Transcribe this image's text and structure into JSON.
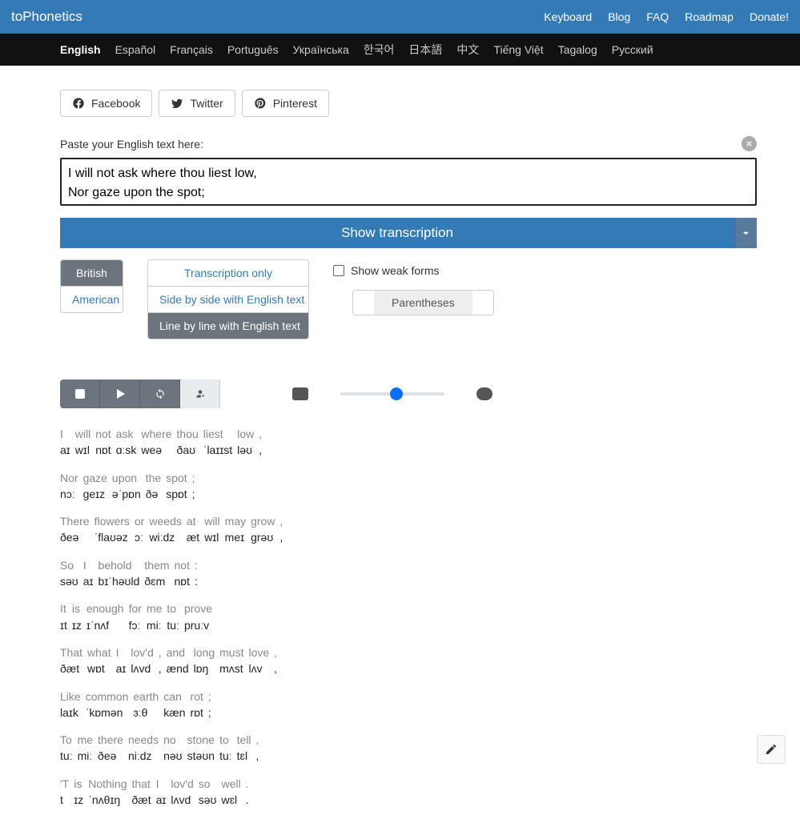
{
  "brand": "toPhonetics",
  "top_links": [
    "Keyboard",
    "Blog",
    "FAQ",
    "Roadmap",
    "Donate!"
  ],
  "languages": [
    "English",
    "Español",
    "Français",
    "Português",
    "Українська",
    "한국어",
    "日本語",
    "中文",
    "Tiếng Việt",
    "Tagalog",
    "Русский"
  ],
  "active_language": "English",
  "share": {
    "facebook": "Facebook",
    "twitter": "Twitter",
    "pinterest": "Pinterest"
  },
  "paste_label": "Paste your English text here:",
  "input_text": "I will not ask where thou liest low,\nNor gaze upon the spot;",
  "show_btn": "Show transcription",
  "dialect": {
    "options": [
      "British",
      "American"
    ],
    "selected": "British"
  },
  "layout_mode": {
    "options": [
      "Transcription only",
      "Side by side with English text",
      "Line by line with English text"
    ],
    "selected": "Line by line with English text"
  },
  "weak_forms_label": "Show weak forms",
  "weak_forms_checked": false,
  "parentheses_label": "Parentheses",
  "output_lines": [
    {
      "pairs": [
        [
          "I",
          "aɪ"
        ],
        [
          "will",
          "wɪl"
        ],
        [
          "not",
          "nɒt"
        ],
        [
          "ask",
          "ɑːsk"
        ],
        [
          "where",
          "weə"
        ],
        [
          "thou",
          "ðaʊ"
        ],
        [
          "liest",
          "ˈlaɪɪst"
        ],
        [
          "low",
          "ləʊ"
        ]
      ],
      "punct": ","
    },
    {
      "pairs": [
        [
          "Nor",
          "nɔː"
        ],
        [
          "gaze",
          "ɡeɪz"
        ],
        [
          "upon",
          "əˈpɒn"
        ],
        [
          "the",
          "ðə"
        ],
        [
          "spot",
          "spɒt"
        ]
      ],
      "punct": ";"
    },
    {
      "pairs": [
        [
          "There",
          "ðeə"
        ],
        [
          "flowers",
          "ˈflaʊəz"
        ],
        [
          "or",
          "ɔː"
        ],
        [
          "weeds",
          "wiːdz"
        ],
        [
          "at",
          "æt"
        ],
        [
          "will",
          "wɪl"
        ],
        [
          "may",
          "meɪ"
        ],
        [
          "grow",
          "ɡrəʊ"
        ]
      ],
      "punct": ","
    },
    {
      "pairs": [
        [
          "So",
          "səʊ"
        ],
        [
          "I",
          "aɪ"
        ],
        [
          "behold",
          "bɪˈhəʊld"
        ],
        [
          "them",
          "ðɛm"
        ],
        [
          "not",
          "nɒt"
        ]
      ],
      "punct": ":"
    },
    {
      "pairs": [
        [
          "It",
          "ɪt"
        ],
        [
          "is",
          "ɪz"
        ],
        [
          "enough",
          "ɪˈnʌf"
        ],
        [
          "for",
          "fɔː"
        ],
        [
          "me",
          "miː"
        ],
        [
          "to",
          "tuː"
        ],
        [
          "prove",
          "pruːv"
        ]
      ],
      "punct": ""
    },
    {
      "pairs": [
        [
          "That",
          "ðæt"
        ],
        [
          "what",
          "wɒt"
        ],
        [
          "I",
          "aɪ"
        ],
        [
          "lov'd",
          "lʌvd"
        ],
        [
          ",",
          ","
        ],
        [
          "and",
          "ænd"
        ],
        [
          "long",
          "lɒŋ"
        ],
        [
          "must",
          "mʌst"
        ],
        [
          "love",
          "lʌv"
        ]
      ],
      "punct": ","
    },
    {
      "pairs": [
        [
          "Like",
          "laɪk"
        ],
        [
          "common",
          "ˈkɒmən"
        ],
        [
          "earth",
          "ɜːθ"
        ],
        [
          "can",
          "kæn"
        ],
        [
          "rot",
          "rɒt"
        ]
      ],
      "punct": ";"
    },
    {
      "pairs": [
        [
          "To",
          "tuː"
        ],
        [
          "me",
          "miː"
        ],
        [
          "there",
          "ðeə"
        ],
        [
          "needs",
          "niːdz"
        ],
        [
          "no",
          "nəʊ"
        ],
        [
          "stone",
          "stəʊn"
        ],
        [
          "to",
          "tuː"
        ],
        [
          "tell",
          "tɛl"
        ]
      ],
      "punct": ","
    },
    {
      "pairs": [
        [
          "'T",
          "t"
        ],
        [
          "is",
          "ɪz"
        ],
        [
          "Nothing",
          "ˈnʌθɪŋ"
        ],
        [
          "that",
          "ðæt"
        ],
        [
          "I",
          "aɪ"
        ],
        [
          "lov'd",
          "lʌvd"
        ],
        [
          "so",
          "səʊ"
        ],
        [
          "well",
          "wɛl"
        ]
      ],
      "punct": "."
    }
  ]
}
